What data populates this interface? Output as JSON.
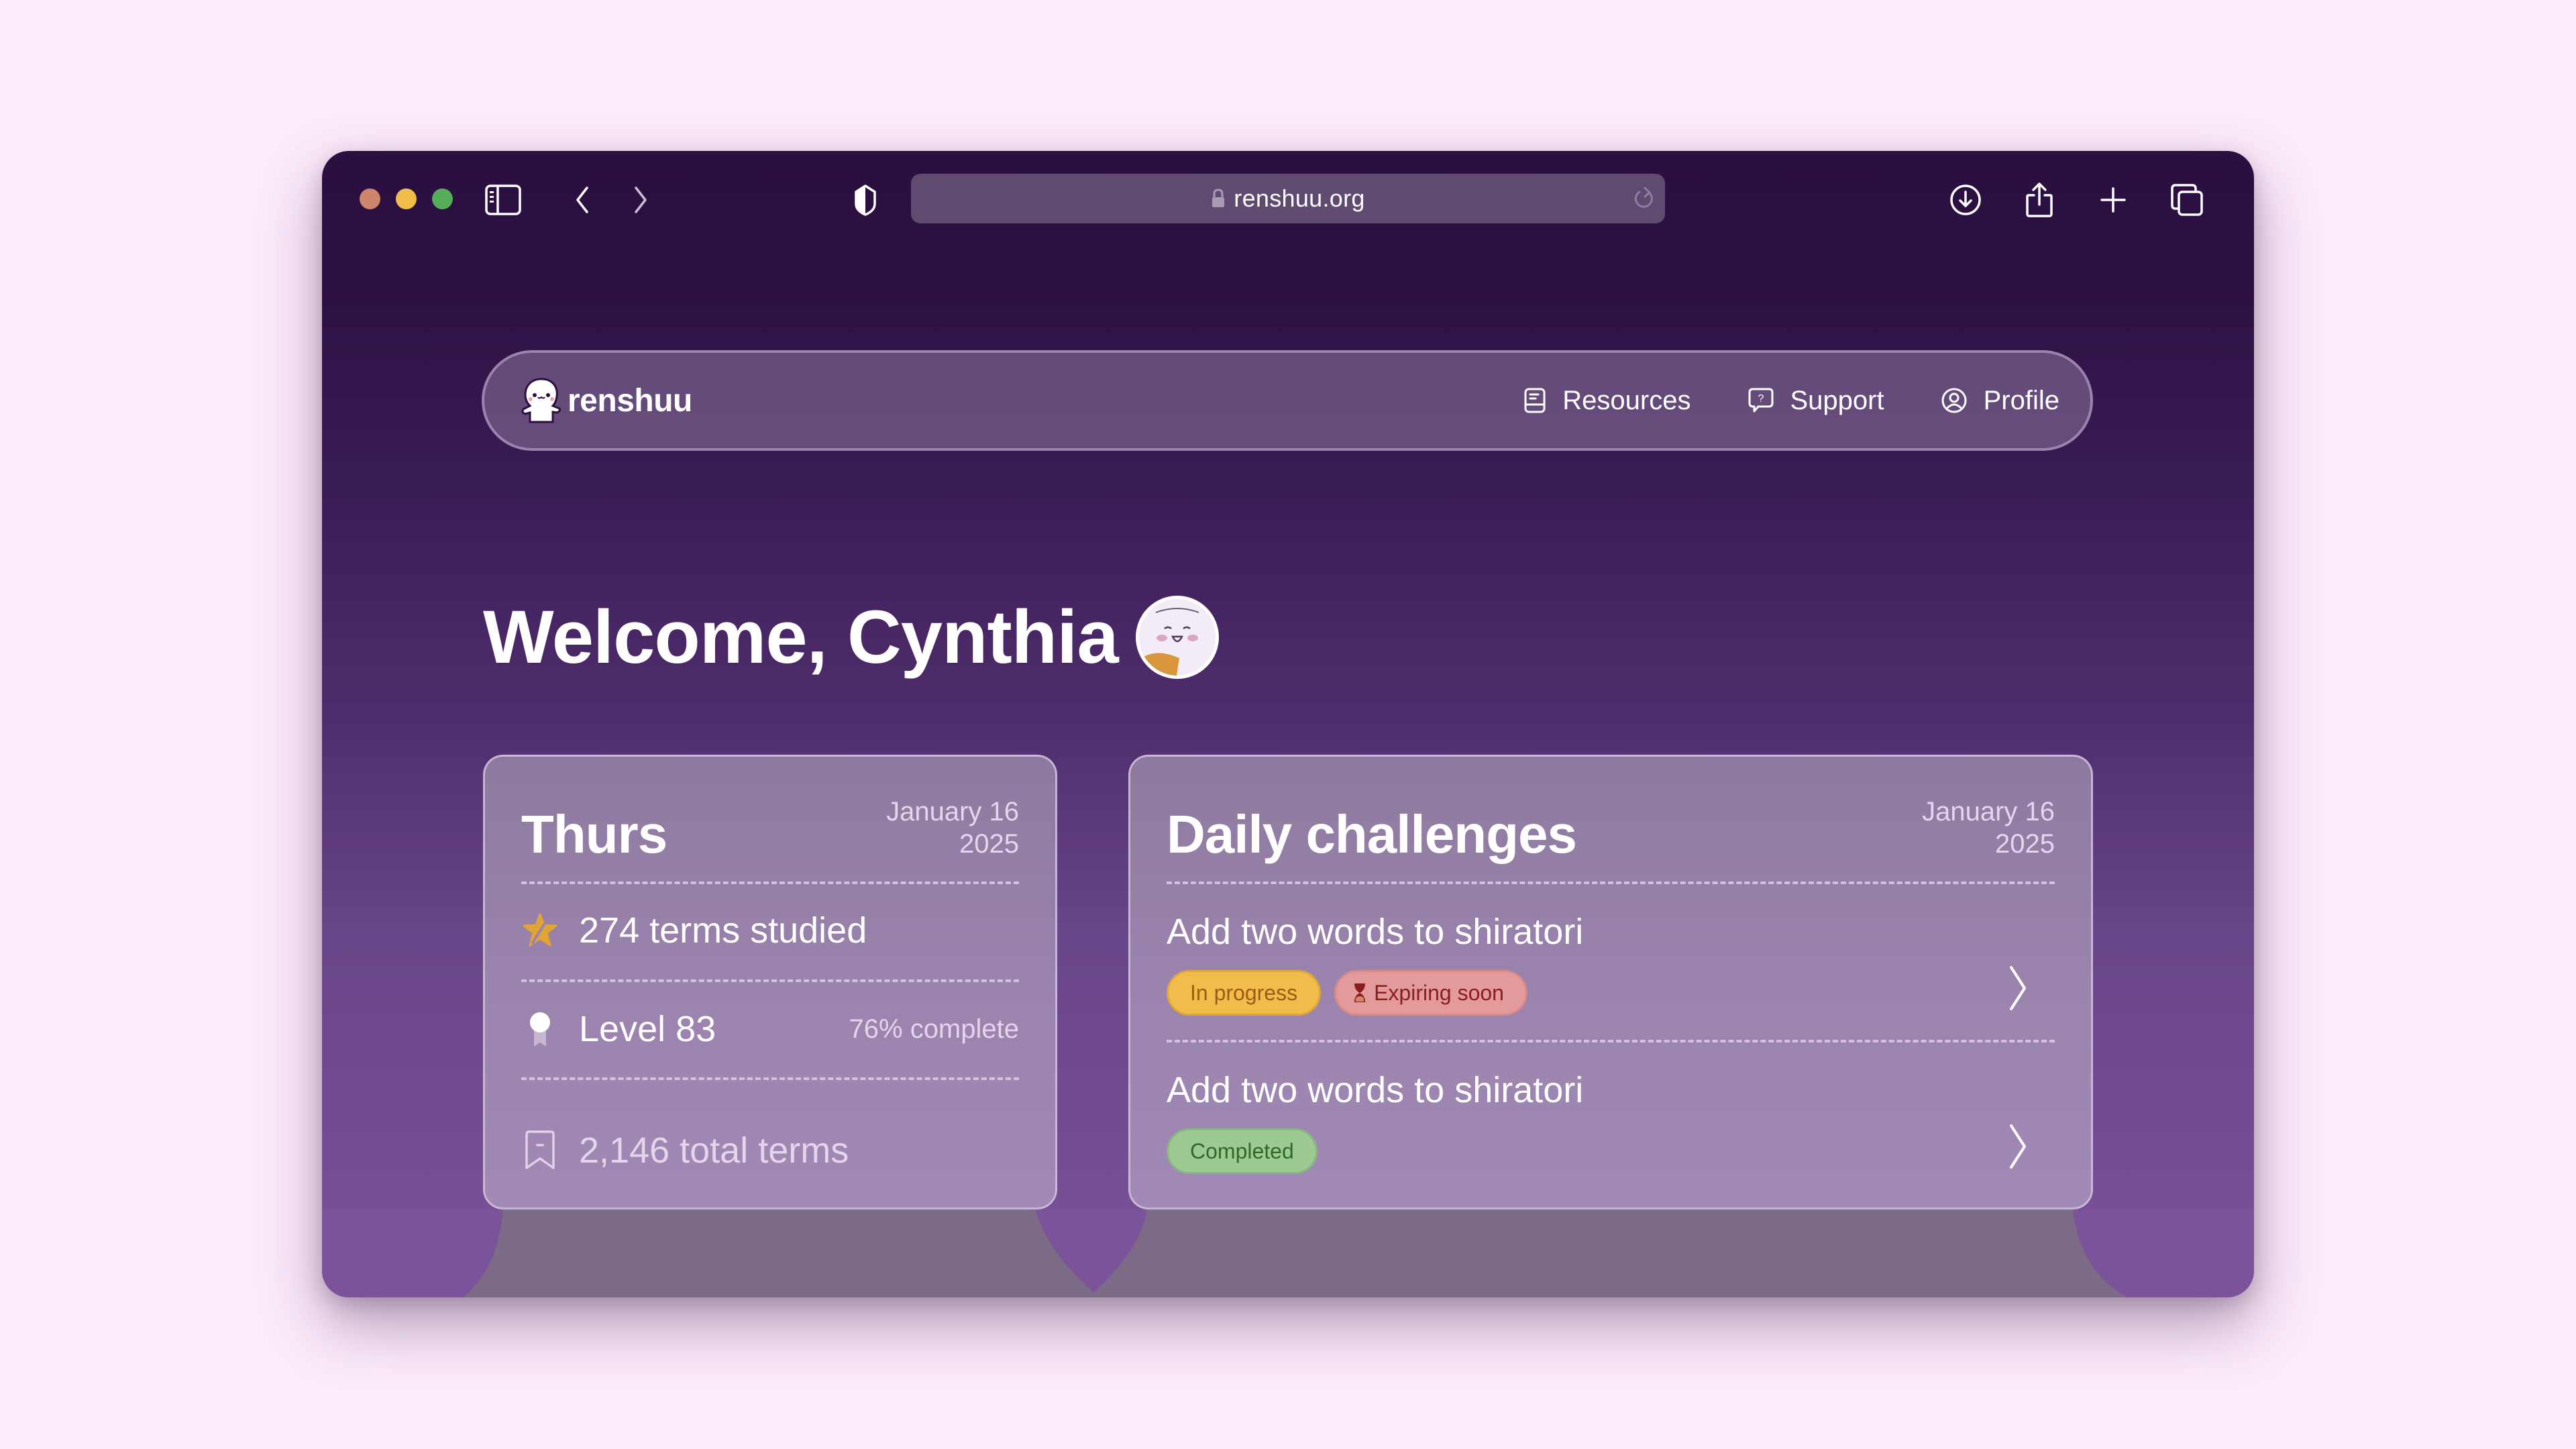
{
  "browser": {
    "url": "renshuu.org",
    "icons": {
      "sidebar": "sidebar-icon",
      "back": "chevron-left-icon",
      "forward": "chevron-right-icon",
      "privacy": "shield-icon",
      "lock": "lock-icon",
      "reload": "reload-icon",
      "download": "download-icon",
      "share": "share-icon",
      "new_tab": "plus-icon",
      "tabs": "tabs-overview-icon"
    }
  },
  "nav": {
    "brand": "renshuu",
    "links": [
      {
        "label": "Resources",
        "icon": "book-icon"
      },
      {
        "label": "Support",
        "icon": "help-bubble-icon"
      },
      {
        "label": "Profile",
        "icon": "user-circle-icon"
      }
    ]
  },
  "welcome": {
    "text": "Welcome, Cynthia"
  },
  "summary_card": {
    "day": "Thurs",
    "date_line1": "January 16",
    "date_line2": "2025",
    "terms_studied": "274 terms studied",
    "level": "Level 83",
    "level_progress": "76% complete",
    "level_progress_percent": 76,
    "total_terms": "2,146 total terms"
  },
  "challenges_card": {
    "title": "Daily challenges",
    "date_line1": "January 16",
    "date_line2": "2025",
    "items": [
      {
        "title": "Add two words to shiratori",
        "badges": [
          "In progress",
          "Expiring soon"
        ]
      },
      {
        "title": "Add two words to shiratori",
        "badges": [
          "Completed"
        ]
      }
    ]
  },
  "colors": {
    "page_bg": "#fcebfb",
    "window_top": "#2b0f40",
    "window_bottom": "#7b539a",
    "badge_in_progress": "#f0bd4b",
    "badge_expiring": "#e39a9a",
    "badge_completed": "#9dca92",
    "star": "#e0a535"
  }
}
